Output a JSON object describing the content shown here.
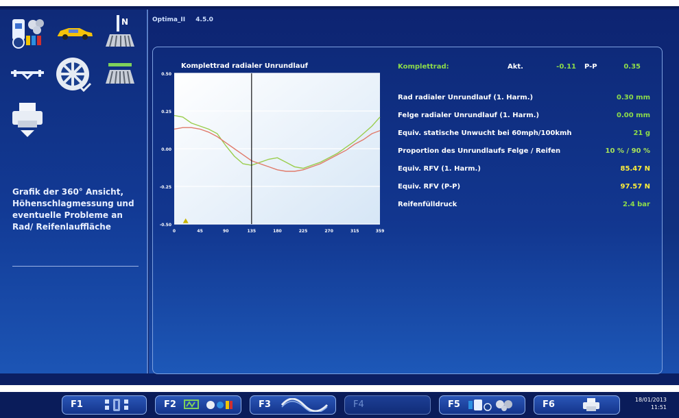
{
  "app": {
    "name": "Optima_II",
    "version": "4.5.0"
  },
  "left_panel": {
    "description": "Grafik der 360° Ansicht, Höhenschlagmessung und eventuelle Probleme an Rad/ Reifenlauffläche",
    "icons": [
      "wheel-balancer-icon",
      "car-icon",
      "tread-n-icon",
      "axle-icon",
      "wheel-rim-icon",
      "tread-icon",
      "printer-icon"
    ],
    "n_badge": "N"
  },
  "chart_data": {
    "type": "line",
    "title": "Komplettrad radialer Unrundlauf",
    "x_ticks": [
      "0",
      "45",
      "90",
      "135",
      "180",
      "225",
      "270",
      "315",
      "359"
    ],
    "y_ticks": [
      "0.50",
      "0.25",
      "0.00",
      "-0.25",
      "-0.50"
    ],
    "xlim": [
      0,
      359
    ],
    "ylim": [
      -0.5,
      0.5
    ],
    "cursor_x": 135,
    "marker": {
      "x": 20,
      "y": -0.48
    },
    "series": [
      {
        "color": "#9acd4c",
        "x": [
          0,
          15,
          30,
          45,
          60,
          75,
          90,
          105,
          120,
          135,
          150,
          165,
          180,
          195,
          210,
          225,
          240,
          255,
          270,
          285,
          300,
          315,
          330,
          345,
          359
        ],
        "y": [
          0.22,
          0.21,
          0.17,
          0.15,
          0.13,
          0.1,
          0.02,
          -0.05,
          -0.1,
          -0.11,
          -0.09,
          -0.07,
          -0.06,
          -0.09,
          -0.12,
          -0.13,
          -0.11,
          -0.09,
          -0.06,
          -0.03,
          0.01,
          0.05,
          0.1,
          0.15,
          0.21
        ]
      },
      {
        "color": "#e07a6a",
        "x": [
          0,
          15,
          30,
          45,
          60,
          75,
          90,
          105,
          120,
          135,
          150,
          165,
          180,
          195,
          210,
          225,
          240,
          255,
          270,
          285,
          300,
          315,
          330,
          345,
          359
        ],
        "y": [
          0.13,
          0.14,
          0.14,
          0.13,
          0.11,
          0.08,
          0.04,
          0.0,
          -0.04,
          -0.08,
          -0.1,
          -0.12,
          -0.14,
          -0.15,
          -0.15,
          -0.14,
          -0.12,
          -0.1,
          -0.07,
          -0.04,
          -0.01,
          0.03,
          0.06,
          0.1,
          0.12
        ]
      }
    ]
  },
  "readings": {
    "komplettrad": {
      "label": "Komplettrad:",
      "akt_label": "Akt.",
      "akt_value": "-0.11",
      "pp_label": "P-P",
      "pp_value": "0.35"
    },
    "rows": [
      {
        "label": "Rad radialer Unrundlauf (1. Harm.)",
        "value": "0.30 mm",
        "color": "green"
      },
      {
        "label": "Felge radialer Unrundlauf (1. Harm.)",
        "value": "0.00 mm",
        "color": "green"
      },
      {
        "label": "Equiv. statische Unwucht bei 60mph/100kmh",
        "value": "21 g",
        "color": "green"
      },
      {
        "label": "Proportion des Unrundlaufs Felge / Reifen",
        "value": "10 % / 90 %",
        "color": "green"
      },
      {
        "label": "Equiv. RFV (1. Harm.)",
        "value": "85.47 N",
        "color": "yellow"
      },
      {
        "label": "Equiv. RFV (P-P)",
        "value": "97.57 N",
        "color": "yellow"
      },
      {
        "label": "Reifenfülldruck",
        "value": "2.4 bar",
        "color": "green"
      }
    ]
  },
  "function_keys": [
    {
      "label": "F1",
      "icon": "keypad-icon",
      "enabled": true
    },
    {
      "label": "F2",
      "icon": "weights-icon",
      "enabled": true
    },
    {
      "label": "F3",
      "icon": "wave-icon",
      "enabled": true
    },
    {
      "label": "F4",
      "icon": "",
      "enabled": false
    },
    {
      "label": "F5",
      "icon": "balancer-icon",
      "enabled": true
    },
    {
      "label": "F6",
      "icon": "printer-icon",
      "enabled": true
    }
  ],
  "clock": {
    "date": "18/01/2013",
    "time": "11:51"
  }
}
